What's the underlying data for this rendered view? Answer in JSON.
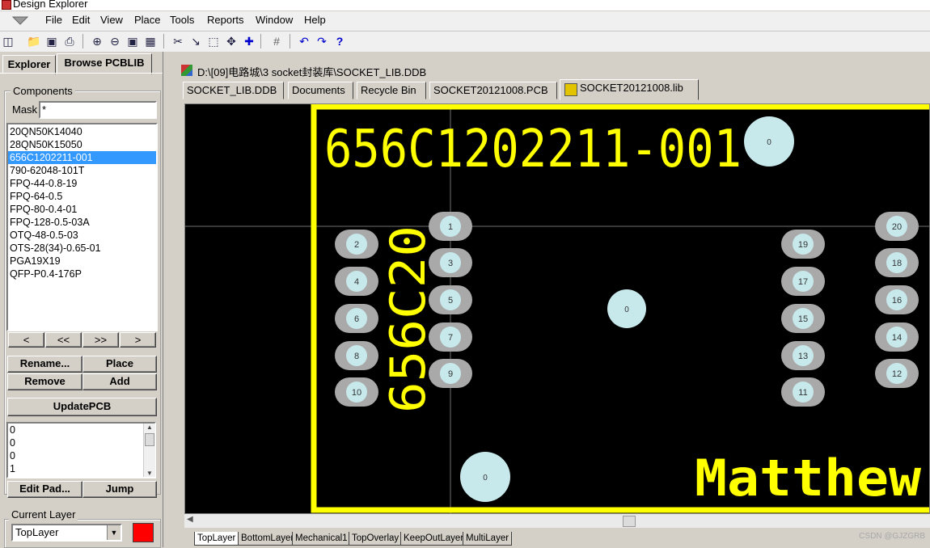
{
  "window": {
    "title": "Design Explorer"
  },
  "menu": [
    "File",
    "Edit",
    "View",
    "Place",
    "Tools",
    "Reports",
    "Window",
    "Help"
  ],
  "toolbar_icons": [
    "design-manager-icon",
    "open-icon",
    "save-icon",
    "print-icon",
    "zoom-in-icon",
    "zoom-out-icon",
    "zoom-fit-icon",
    "route-icon",
    "line-icon",
    "select-icon",
    "move-icon",
    "crosshair-icon",
    "grid-icon",
    "undo-icon",
    "redo-icon",
    "help-icon"
  ],
  "left_tabs": {
    "explorer": "Explorer",
    "browse": "Browse PCBLIB"
  },
  "components": {
    "label": "Components",
    "mask_label": "Mask",
    "mask_value": "*",
    "items": [
      "20QN50K14040",
      "28QN50K15050",
      "656C1202211-001",
      "790-62048-101T",
      "FPQ-44-0.8-19",
      "FPQ-64-0.5",
      "FPQ-80-0.4-01",
      "FPQ-128-0.5-03A",
      "OTQ-48-0.5-03",
      "OTS-28(34)-0.65-01",
      "PGA19X19",
      "QFP-P0.4-176P"
    ],
    "selected_index": 2,
    "nav": [
      "<",
      "<<",
      ">>",
      ">"
    ]
  },
  "buttons": {
    "rename": "Rename...",
    "place": "Place",
    "remove": "Remove",
    "add": "Add",
    "update": "UpdatePCB",
    "edit_pad": "Edit Pad...",
    "jump": "Jump"
  },
  "pad_list": [
    "0",
    "0",
    "0",
    "1"
  ],
  "current_layer": {
    "label": "Current Layer",
    "value": "TopLayer",
    "color": "#ff0000"
  },
  "doc": {
    "path": "D:\\[09]电路城\\3 socket封装库\\SOCKET_LIB.DDB",
    "tabs": [
      "SOCKET_LIB.DDB",
      "Documents",
      "Recycle Bin",
      "SOCKET20121008.PCB",
      "SOCKET20121008.lib"
    ],
    "active_tab": 4
  },
  "pcb": {
    "title_text": "656C1202211-001",
    "vertical_text": "656C20",
    "signature": "Matthew",
    "pads": [
      "1",
      "2",
      "3",
      "4",
      "5",
      "6",
      "7",
      "8",
      "9",
      "10",
      "11",
      "12",
      "13",
      "14",
      "15",
      "16",
      "17",
      "18",
      "19",
      "20"
    ],
    "mounting_holes": [
      "0",
      "0",
      "0"
    ],
    "colors": {
      "outline": "#ffff00",
      "pad": "#a9a9a9",
      "hole": "#c8e9ec",
      "background": "#000000"
    }
  },
  "layer_tabs": [
    "TopLayer",
    "BottomLayer",
    "Mechanical1",
    "TopOverlay",
    "KeepOutLayer",
    "MultiLayer"
  ],
  "watermark": "CSDN @GJZGRB"
}
